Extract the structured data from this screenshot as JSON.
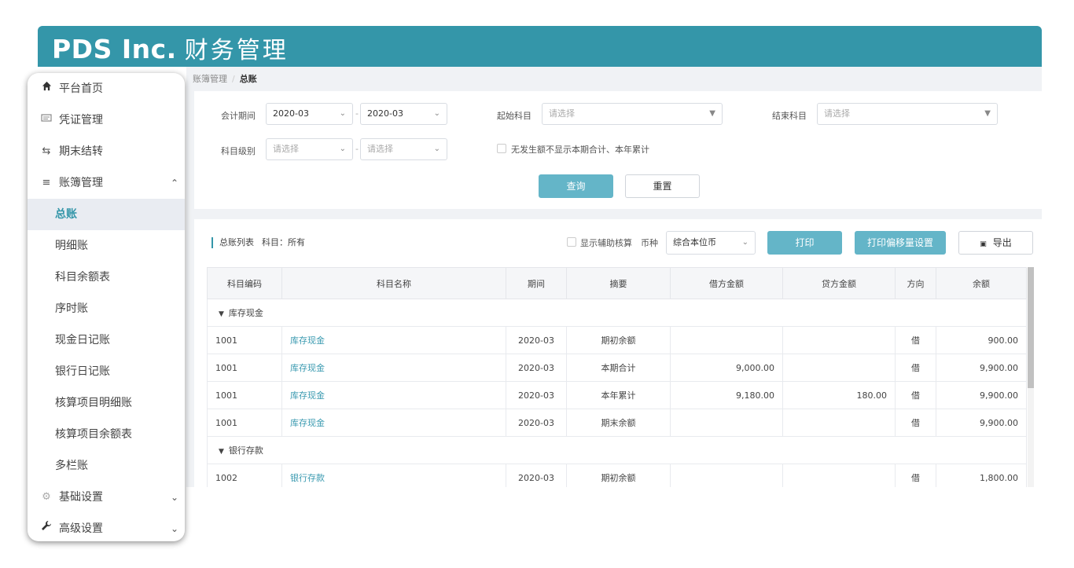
{
  "header": {
    "brand": "PDS Inc.",
    "title": "财务管理"
  },
  "breadcrumb": {
    "parent": "账簿管理",
    "sep": "/",
    "current": "总账"
  },
  "sidebar": {
    "items": [
      {
        "label": "平台首页",
        "icon": "home-icon"
      },
      {
        "label": "凭证管理",
        "icon": "voucher-icon"
      },
      {
        "label": "期末结转",
        "icon": "transfer-icon"
      },
      {
        "label": "账簿管理",
        "icon": "list-icon",
        "expanded": true
      },
      {
        "label": "总账",
        "active": true
      },
      {
        "label": "明细账"
      },
      {
        "label": "科目余额表"
      },
      {
        "label": "序时账"
      },
      {
        "label": "现金日记账"
      },
      {
        "label": "银行日记账"
      },
      {
        "label": "核算项目明细账"
      },
      {
        "label": "核算项目余额表"
      },
      {
        "label": "多栏账"
      },
      {
        "label": "基础设置",
        "icon": "gear-icon"
      },
      {
        "label": "高级设置",
        "icon": "wrench-icon"
      }
    ]
  },
  "filters": {
    "period_label": "会计期间",
    "period_from": "2020-03",
    "period_to": "2020-03",
    "start_subject_label": "起始科目",
    "start_subject_placeholder": "请选择",
    "end_subject_label": "结束科目",
    "end_subject_placeholder": "请选择",
    "level_label": "科目级别",
    "level_from_placeholder": "请选择",
    "level_to_placeholder": "请选择",
    "range_sep": "-",
    "hide_zero_label": "无发生额不显示本期合计、本年累计",
    "query_label": "查询",
    "reset_label": "重置"
  },
  "list": {
    "title": "总账列表",
    "subject_filter": "科目：所有",
    "show_aux_label": "显示辅助核算",
    "currency_label": "币种",
    "currency_value": "综合本位币",
    "print_label": "打印",
    "print_offset_label": "打印偏移量设置",
    "export_label": "导出"
  },
  "table": {
    "columns": [
      "科目编码",
      "科目名称",
      "期间",
      "摘要",
      "借方金额",
      "贷方金额",
      "方向",
      "余额"
    ],
    "groups": [
      {
        "name": "库存现金",
        "rows": [
          {
            "code": "1001",
            "name": "库存现金",
            "period": "2020-03",
            "summary": "期初余额",
            "debit": "",
            "credit": "",
            "direction": "借",
            "balance": "900.00"
          },
          {
            "code": "1001",
            "name": "库存现金",
            "period": "2020-03",
            "summary": "本期合计",
            "debit": "9,000.00",
            "credit": "",
            "direction": "借",
            "balance": "9,900.00"
          },
          {
            "code": "1001",
            "name": "库存现金",
            "period": "2020-03",
            "summary": "本年累计",
            "debit": "9,180.00",
            "credit": "180.00",
            "direction": "借",
            "balance": "9,900.00"
          },
          {
            "code": "1001",
            "name": "库存现金",
            "period": "2020-03",
            "summary": "期末余额",
            "debit": "",
            "credit": "",
            "direction": "借",
            "balance": "9,900.00"
          }
        ]
      },
      {
        "name": "银行存款",
        "rows": [
          {
            "code": "1002",
            "name": "银行存款",
            "period": "2020-03",
            "summary": "期初余额",
            "debit": "",
            "credit": "",
            "direction": "借",
            "balance": "1,800.00"
          }
        ]
      }
    ]
  }
}
